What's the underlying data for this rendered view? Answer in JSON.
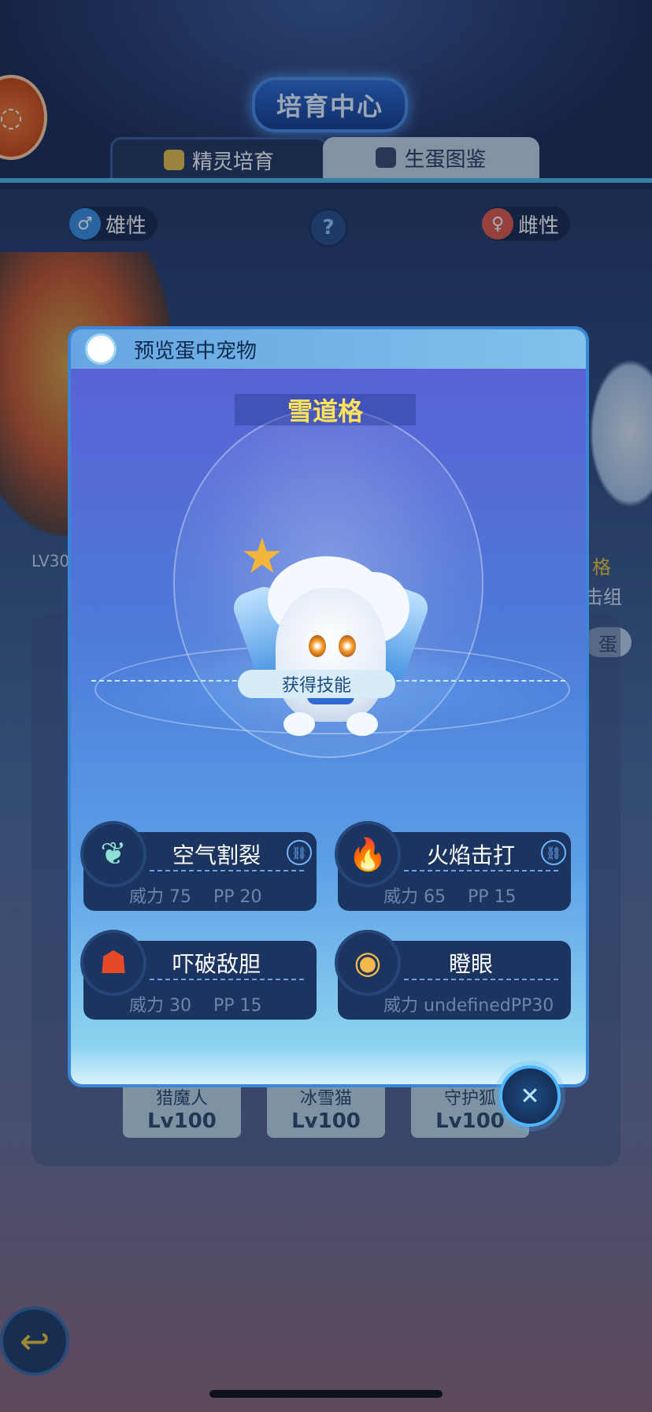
{
  "header": {
    "title": "培育中心"
  },
  "tabs": [
    {
      "label": "精灵培育",
      "active": true
    },
    {
      "label": "生蛋图鉴",
      "active": false
    }
  ],
  "parents": {
    "male_label": "雄性",
    "female_label": "雌性",
    "help_icon": "?"
  },
  "background": {
    "left_level": "LV30",
    "right_chip": "蛋",
    "right_label_1": "格",
    "right_label_2": "击组",
    "cards": [
      {
        "name": "猎魔人",
        "level": "Lv100"
      },
      {
        "name": "冰雪猫",
        "level": "Lv100"
      },
      {
        "name": "守护狐",
        "level": "Lv100"
      }
    ]
  },
  "modal": {
    "title": "预览蛋中宠物",
    "pet_name": "雪道格",
    "skills_header": "获得技能",
    "skills": [
      {
        "name": "空气割裂",
        "power_label": "威力",
        "power": "75",
        "pp_label": "PP",
        "pp": "20",
        "icon": "wind-wing-icon",
        "color": "#8ee0d4"
      },
      {
        "name": "火焰击打",
        "power_label": "威力",
        "power": "65",
        "pp_label": "PP",
        "pp": "15",
        "icon": "flame-icon",
        "color": "#f05a3a"
      },
      {
        "name": "吓破敌胆",
        "power_label": "威力",
        "power": "30",
        "pp_label": "PP",
        "pp": "15",
        "icon": "ghost-icon",
        "color": "#e44a2a"
      },
      {
        "name": "瞪眼",
        "power_label": "威力",
        "power": "undefined",
        "pp_label": "PP",
        "pp": "30",
        "icon": "eye-shield-icon",
        "color": "#f5b84a"
      }
    ]
  },
  "colors": {
    "accent": "#4fb7e8",
    "pet_name": "#ffe35a",
    "card_bg": "#1b3560"
  }
}
